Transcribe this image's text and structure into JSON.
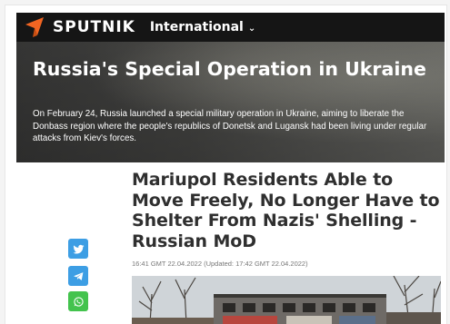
{
  "header": {
    "logo_text": "SPUTNIK",
    "edition_label": "International",
    "brand_color": "#f26522"
  },
  "hero": {
    "title": "Russia's Special Operation in Ukraine",
    "description": "On February 24, Russia launched a special military operation in Ukraine, aiming to liberate the Donbass region where the people's republics of Donetsk and Lugansk had been living under regular attacks from Kiev's forces."
  },
  "article": {
    "headline": "Mariupol Residents Able to Move Freely, No Longer Have to Shelter From Nazis' Shelling - Russian MoD",
    "dateline": "16:41 GMT 22.04.2022 (Updated: 17:42 GMT 22.04.2022)"
  },
  "share": {
    "icons": [
      "twitter-icon",
      "telegram-icon",
      "whatsapp-icon"
    ],
    "twitter_color": "#3d9ee4",
    "telegram_color": "#3d9ee4",
    "whatsapp_color": "#43c34d"
  }
}
